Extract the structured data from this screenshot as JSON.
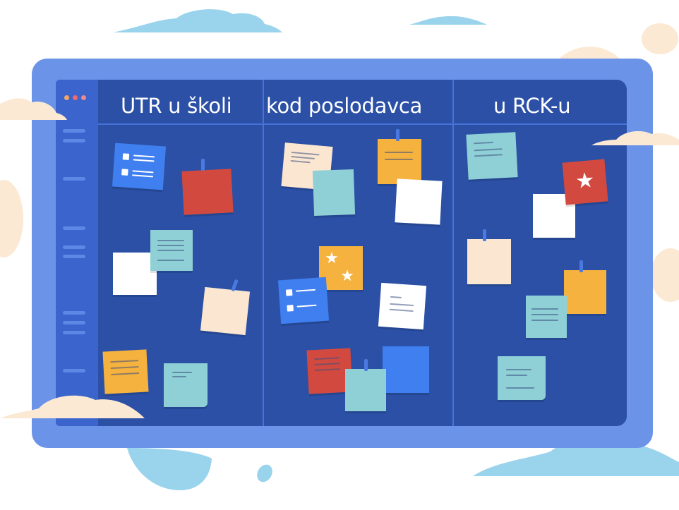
{
  "board": {
    "columns": [
      {
        "title": "UTR u školi"
      },
      {
        "title": "kod poslodavca"
      },
      {
        "title": "u RCK-u"
      }
    ]
  },
  "window_dots": [
    "#f0a868",
    "#f06a6a",
    "#f09090"
  ],
  "colors": {
    "monitor_frame": "#6b93e8",
    "screen": "#2b50a6",
    "sidebar": "#3b64cc",
    "cloud_blue": "#9ad3ec",
    "cloud_cream": "#fbe9d4"
  },
  "icons": [
    "star-icon",
    "checkbox-icon",
    "pin-icon"
  ]
}
